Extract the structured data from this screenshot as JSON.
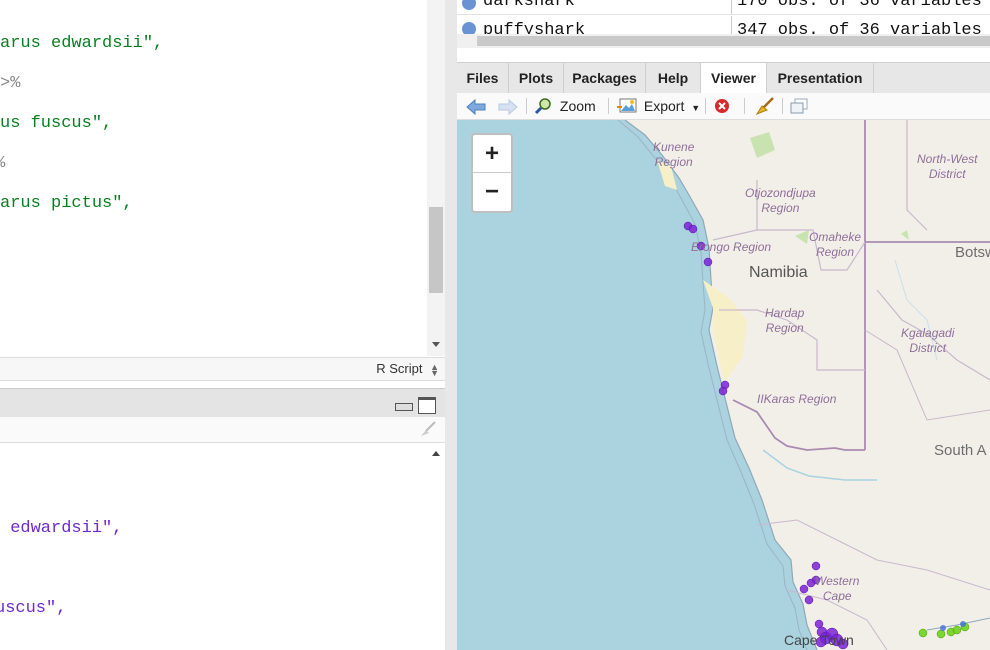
{
  "editor": {
    "lines": [
      {
        "text": "arus edwardsii\",",
        "kind": "str"
      },
      {
        "text": ">%",
        "kind": "op"
      },
      {
        "text": "us fuscus\",",
        "kind": "str"
      },
      {
        "text": "%",
        "kind": "op"
      },
      {
        "text": "arus pictus\",",
        "kind": "str"
      }
    ],
    "status": {
      "filetype": "R Script"
    }
  },
  "console": {
    "lines": [
      " edwardsii\",",
      "uscus\","
    ]
  },
  "environment": {
    "rows": [
      {
        "name": "darkshark",
        "value": "170 obs. of 36 variables"
      },
      {
        "name": "puffyshark",
        "value": "347 obs. of 36 variables"
      }
    ]
  },
  "viewer": {
    "tabs": [
      "Files",
      "Plots",
      "Packages",
      "Help",
      "Viewer",
      "Presentation"
    ],
    "active_tab": "Viewer",
    "toolbar": {
      "zoom_label": "Zoom",
      "export_label": "Export"
    },
    "map": {
      "zoom_in": "+",
      "zoom_out": "−",
      "regions": [
        "Kunene\nRegion",
        "Otjozondjupa\nRegion",
        "Erongo Region",
        "Omaheke\nRegion",
        "Hardap\nRegion",
        "IIKaras Region",
        "North-West\nDistrict",
        "Kgalagadi\nDistrict",
        "Western\nCape"
      ],
      "countries": [
        "Namibia",
        "Botsw",
        "South A",
        "Cape Town"
      ],
      "colors": {
        "ocean": "#aad3df",
        "land": "#f2efe9",
        "purple_points": "#7b22d6",
        "green_points": "#6fd11c"
      }
    }
  }
}
